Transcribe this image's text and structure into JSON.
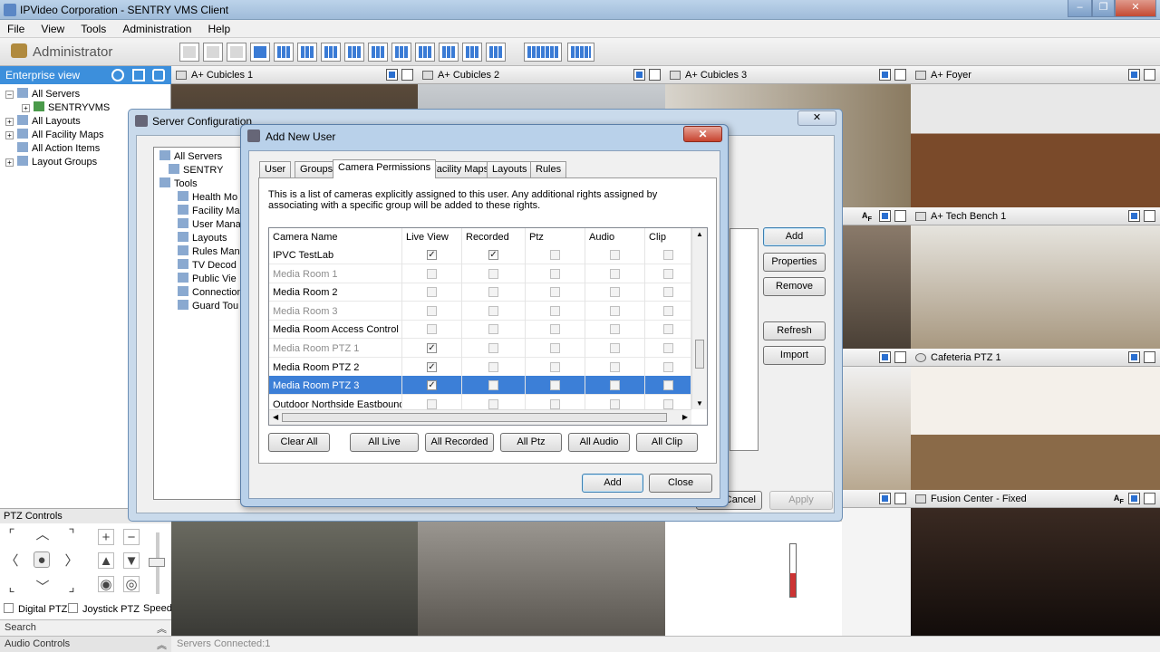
{
  "window": {
    "title": "IPVideo Corporation - SENTRY VMS Client"
  },
  "menu": [
    "File",
    "View",
    "Tools",
    "Administration",
    "Help"
  ],
  "toolbar": {
    "user_label": "Administrator"
  },
  "left": {
    "enterprise_view": "Enterprise view",
    "tree": [
      {
        "label": "All Servers",
        "level": 0
      },
      {
        "label": "SENTRYVMS",
        "level": 1
      },
      {
        "label": "All Layouts",
        "level": 0
      },
      {
        "label": "All Facility Maps",
        "level": 0
      },
      {
        "label": "All Action Items",
        "level": 0
      },
      {
        "label": "Layout Groups",
        "level": 0
      }
    ],
    "ptz_header": "PTZ Controls",
    "digital_ptz": "Digital PTZ",
    "joystick_ptz": "Joystick PTZ",
    "speed": "Speed",
    "search": "Search",
    "audio_controls": "Audio Controls"
  },
  "status": {
    "text": "Servers Connected:1"
  },
  "cameras": [
    {
      "title": "A+ Cubicles 1"
    },
    {
      "title": "A+ Cubicles 2"
    },
    {
      "title": "A+ Cubicles 3"
    },
    {
      "title": "A+ Foyer"
    },
    {
      "title": "A+ Tech Bench 1"
    },
    {
      "title": "Cafeteria PTZ 1"
    },
    {
      "title": "Fusion Center - Fixed"
    }
  ],
  "server_config": {
    "title": "Server Configuration",
    "tree": [
      "All Servers",
      "SENTRY",
      "Tools",
      "Health Mo",
      "Facility Ma",
      "User Mana",
      "Layouts",
      "Rules Man",
      "TV Decod",
      "Public Vie",
      "Connection",
      "Guard Tou"
    ],
    "buttons": {
      "add": "Add",
      "properties": "Properties",
      "remove": "Remove",
      "refresh": "Refresh",
      "import": "Import",
      "cancel": "Cancel",
      "apply": "Apply"
    }
  },
  "dialog": {
    "title": "Add New User",
    "tabs": [
      "User",
      "Groups",
      "Camera Permissions",
      "Facility Maps",
      "Layouts",
      "Rules"
    ],
    "description": "This is a list of cameras explicitly assigned to this user.  Any additional rights assigned by associating with a specific group will be added to these rights.",
    "columns": [
      "Camera Name",
      "Live View",
      "Recorded",
      "Ptz",
      "Audio",
      "Clip"
    ],
    "rows": [
      {
        "name": "IPVC TestLab",
        "gray": false,
        "live": true,
        "recorded": true,
        "ptz": false,
        "audio": false,
        "clip": false,
        "selected": false
      },
      {
        "name": "Media Room 1",
        "gray": true,
        "live": false,
        "recorded": false,
        "ptz": false,
        "audio": false,
        "clip": false,
        "selected": false
      },
      {
        "name": "Media Room 2",
        "gray": false,
        "live": false,
        "recorded": false,
        "ptz": false,
        "audio": false,
        "clip": false,
        "selected": false
      },
      {
        "name": "Media Room 3",
        "gray": true,
        "live": false,
        "recorded": false,
        "ptz": false,
        "audio": false,
        "clip": false,
        "selected": false
      },
      {
        "name": "Media Room Access Control",
        "gray": false,
        "live": false,
        "recorded": false,
        "ptz": false,
        "audio": false,
        "clip": false,
        "selected": false
      },
      {
        "name": "Media Room PTZ 1",
        "gray": true,
        "live": true,
        "recorded": false,
        "ptz": false,
        "audio": false,
        "clip": false,
        "selected": false
      },
      {
        "name": "Media Room PTZ 2",
        "gray": false,
        "live": true,
        "recorded": false,
        "ptz": false,
        "audio": false,
        "clip": false,
        "selected": false
      },
      {
        "name": "Media Room PTZ 3",
        "gray": false,
        "live": true,
        "recorded": false,
        "ptz": false,
        "audio": false,
        "clip": false,
        "selected": true
      },
      {
        "name": "Outdoor Northside Eastbound",
        "gray": false,
        "live": false,
        "recorded": false,
        "ptz": false,
        "audio": false,
        "clip": false,
        "selected": false
      }
    ],
    "bulk_buttons": [
      "Clear All",
      "All Live",
      "All Recorded",
      "All Ptz",
      "All Audio",
      "All Clip"
    ],
    "add_button": "Add",
    "close_button": "Close"
  },
  "colors": {
    "accent": "#3c8fdc",
    "selection": "#3c7fd7"
  }
}
